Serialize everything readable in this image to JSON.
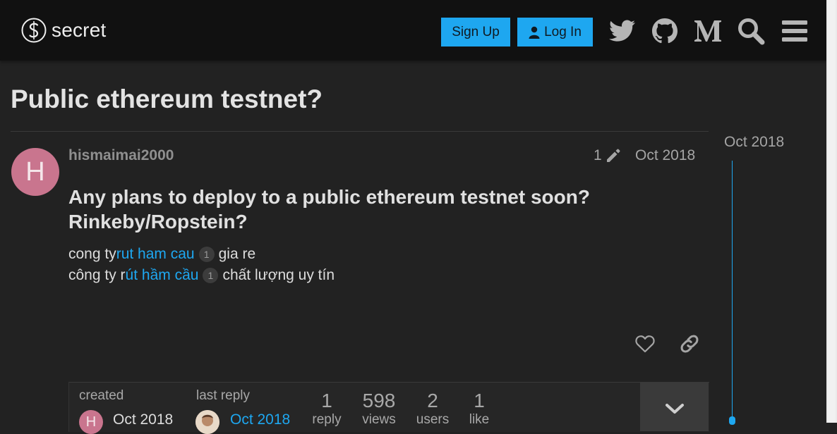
{
  "header": {
    "site_name": "secret",
    "signup_label": "Sign Up",
    "login_label": "Log In",
    "icons": [
      "twitter-icon",
      "github-icon",
      "medium-icon",
      "search-icon",
      "hamburger-menu-icon"
    ],
    "accent_color": "#1ea7f0",
    "background_color": "#111111"
  },
  "topic": {
    "title": "Public ethereum testnet?"
  },
  "post": {
    "avatar_letter": "H",
    "avatar_color": "#c9758e",
    "username": "hismaimai2000",
    "edit_count": "1",
    "date": "Oct 2018",
    "heading_line1": "Any plans to deploy to a public ethereum testnet soon?",
    "heading_line2": "Rinkeby/Ropstein?",
    "body": {
      "line1_prefix": "cong ty",
      "line1_link": "rut ham cau",
      "line1_badge": "1",
      "line1_suffix": "gia re",
      "line2_prefix": "công ty r",
      "line2_link": "út hầm cầu",
      "line2_badge": "1",
      "line2_suffix": "chất lượng uy tín"
    }
  },
  "topic_map": {
    "created_label": "created",
    "created_avatar_letter": "H",
    "created_date": "Oct 2018",
    "last_reply_label": "last reply",
    "last_reply_date": "Oct 2018",
    "stats": [
      {
        "value": "1",
        "label": "reply"
      },
      {
        "value": "598",
        "label": "views"
      },
      {
        "value": "2",
        "label": "users"
      },
      {
        "value": "1",
        "label": "like"
      }
    ]
  },
  "timeline": {
    "date": "Oct 2018"
  }
}
